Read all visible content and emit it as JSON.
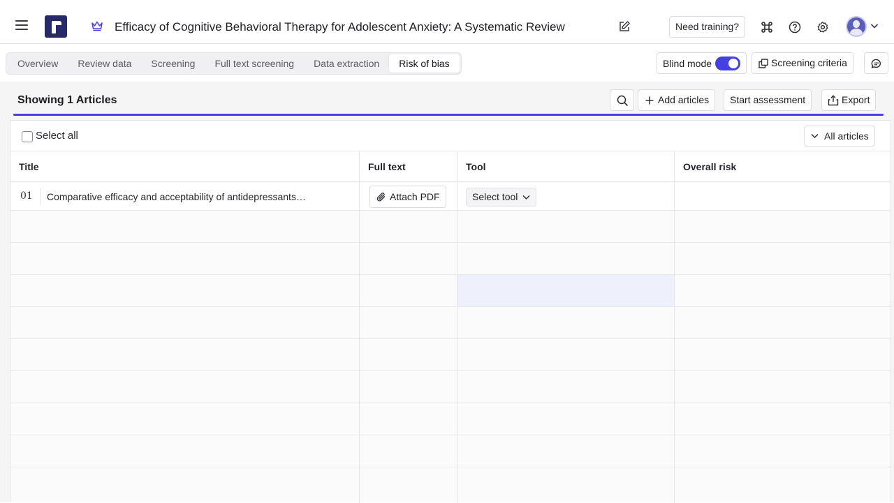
{
  "header": {
    "review_title": "Efficacy of Cognitive Behavioral Therapy for Adolescent Anxiety: A Systematic Review",
    "training_label": "Need training?"
  },
  "tabs": [
    {
      "label": "Overview",
      "active": false
    },
    {
      "label": "Review data",
      "active": false
    },
    {
      "label": "Screening",
      "active": false
    },
    {
      "label": "Full text screening",
      "active": false
    },
    {
      "label": "Data extraction",
      "active": false
    },
    {
      "label": "Risk of bias",
      "active": true
    }
  ],
  "toolbar": {
    "blind_mode_label": "Blind mode",
    "blind_mode_on": true,
    "screening_criteria_label": "Screening criteria"
  },
  "list": {
    "showing_label": "Showing 1 Articles",
    "add_articles_label": "Add articles",
    "start_assessment_label": "Start assessment",
    "export_label": "Export",
    "select_all_label": "Select all",
    "filter_label": "All articles"
  },
  "table": {
    "columns": [
      "Title",
      "Full text",
      "Tool",
      "Overall risk"
    ],
    "rows": [
      {
        "num": "01",
        "title": "Comparative efficacy and acceptability of antidepressants…",
        "attach_label": "Attach PDF",
        "tool_label": "Select tool",
        "overall_risk": ""
      }
    ]
  },
  "colors": {
    "accent": "#4b40e0",
    "logo": "#262a6b",
    "toggle": "#4540e3"
  }
}
